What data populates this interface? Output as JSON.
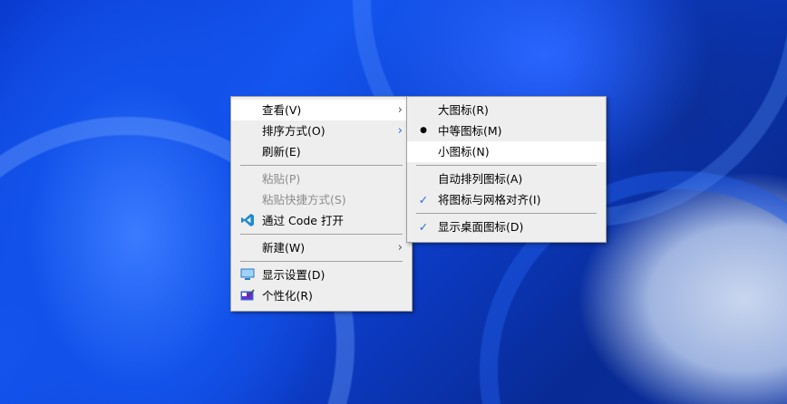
{
  "context_menu": {
    "items": [
      {
        "label": "查看(V)",
        "submenu": true,
        "highlighted": true
      },
      {
        "label": "排序方式(O)",
        "submenu": true
      },
      {
        "label": "刷新(E)"
      },
      {
        "label": "粘贴(P)",
        "disabled": true
      },
      {
        "label": "粘贴快捷方式(S)",
        "disabled": true
      },
      {
        "label": "通过 Code 打开",
        "icon": "vscode-icon"
      },
      {
        "label": "新建(W)",
        "submenu": true
      },
      {
        "label": "显示设置(D)",
        "icon": "display-icon"
      },
      {
        "label": "个性化(R)",
        "icon": "personalize-icon"
      }
    ]
  },
  "view_submenu": {
    "items": [
      {
        "label": "大图标(R)"
      },
      {
        "label": "中等图标(M)",
        "selected": true
      },
      {
        "label": "小图标(N)",
        "highlighted": true
      },
      {
        "label": "自动排列图标(A)",
        "checked": false
      },
      {
        "label": "将图标与网格对齐(I)",
        "checked": true
      },
      {
        "label": "显示桌面图标(D)",
        "checked": true
      }
    ]
  },
  "icons": {
    "bullet": "●",
    "check": "✓",
    "chevron": "›"
  },
  "colors": {
    "check": "#1e6fd0",
    "vscode": "#1f8ad2",
    "menu_bg": "#eeeeee"
  }
}
